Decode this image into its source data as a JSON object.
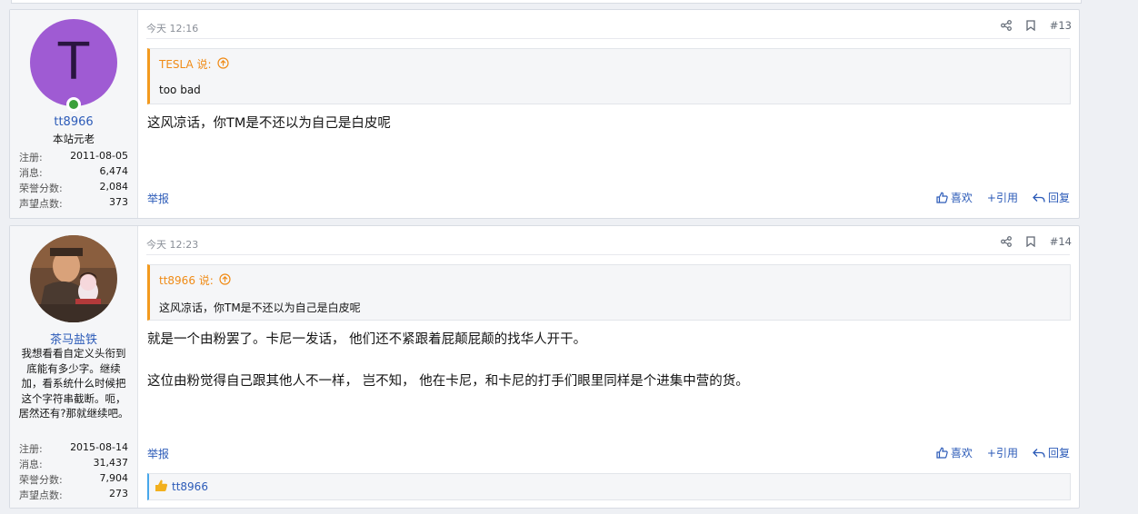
{
  "posts": [
    {
      "user": {
        "avatar_letter": "T",
        "avatar_color": "#9f5bd3",
        "name": "tt8966",
        "title": "本站元老",
        "stats": [
          {
            "label": "注册:",
            "value": "2011-08-05"
          },
          {
            "label": "消息:",
            "value": "6,474"
          },
          {
            "label": "荣誉分数:",
            "value": "2,084"
          },
          {
            "label": "声望点数:",
            "value": "373"
          }
        ]
      },
      "time": "今天 12:16",
      "number": "#13",
      "quote": {
        "author": "TESLA 说:",
        "text": "too bad"
      },
      "body": [
        "这风凉话，你TM是不还以为自己是白皮呢"
      ],
      "report": "举报",
      "actions": {
        "like": "喜欢",
        "quote": "+引用",
        "reply": "回复"
      }
    },
    {
      "user": {
        "name": "茶马盐铁",
        "title": "我想看看自定义头衔到底能有多少字。继续加，看系统什么时候把这个字符串截断。呃，居然还有?那就继续吧。",
        "stats": [
          {
            "label": "注册:",
            "value": "2015-08-14"
          },
          {
            "label": "消息:",
            "value": "31,437"
          },
          {
            "label": "荣誉分数:",
            "value": "7,904"
          },
          {
            "label": "声望点数:",
            "value": "273"
          }
        ]
      },
      "time": "今天 12:23",
      "number": "#14",
      "quote": {
        "author": "tt8966 说:",
        "text": "这风凉话，你TM是不还以为自己是白皮呢"
      },
      "body": [
        "就是一个由粉罢了。卡尼一发话， 他们还不紧跟着屁颠屁颠的找华人开干。",
        "这位由粉觉得自己跟其他人不一样， 岂不知， 他在卡尼，和卡尼的打手们眼里同样是个进集中营的货。"
      ],
      "report": "举报",
      "actions": {
        "like": "喜欢",
        "quote": "+引用",
        "reply": "回复"
      },
      "liked_by": "tt8966"
    }
  ]
}
